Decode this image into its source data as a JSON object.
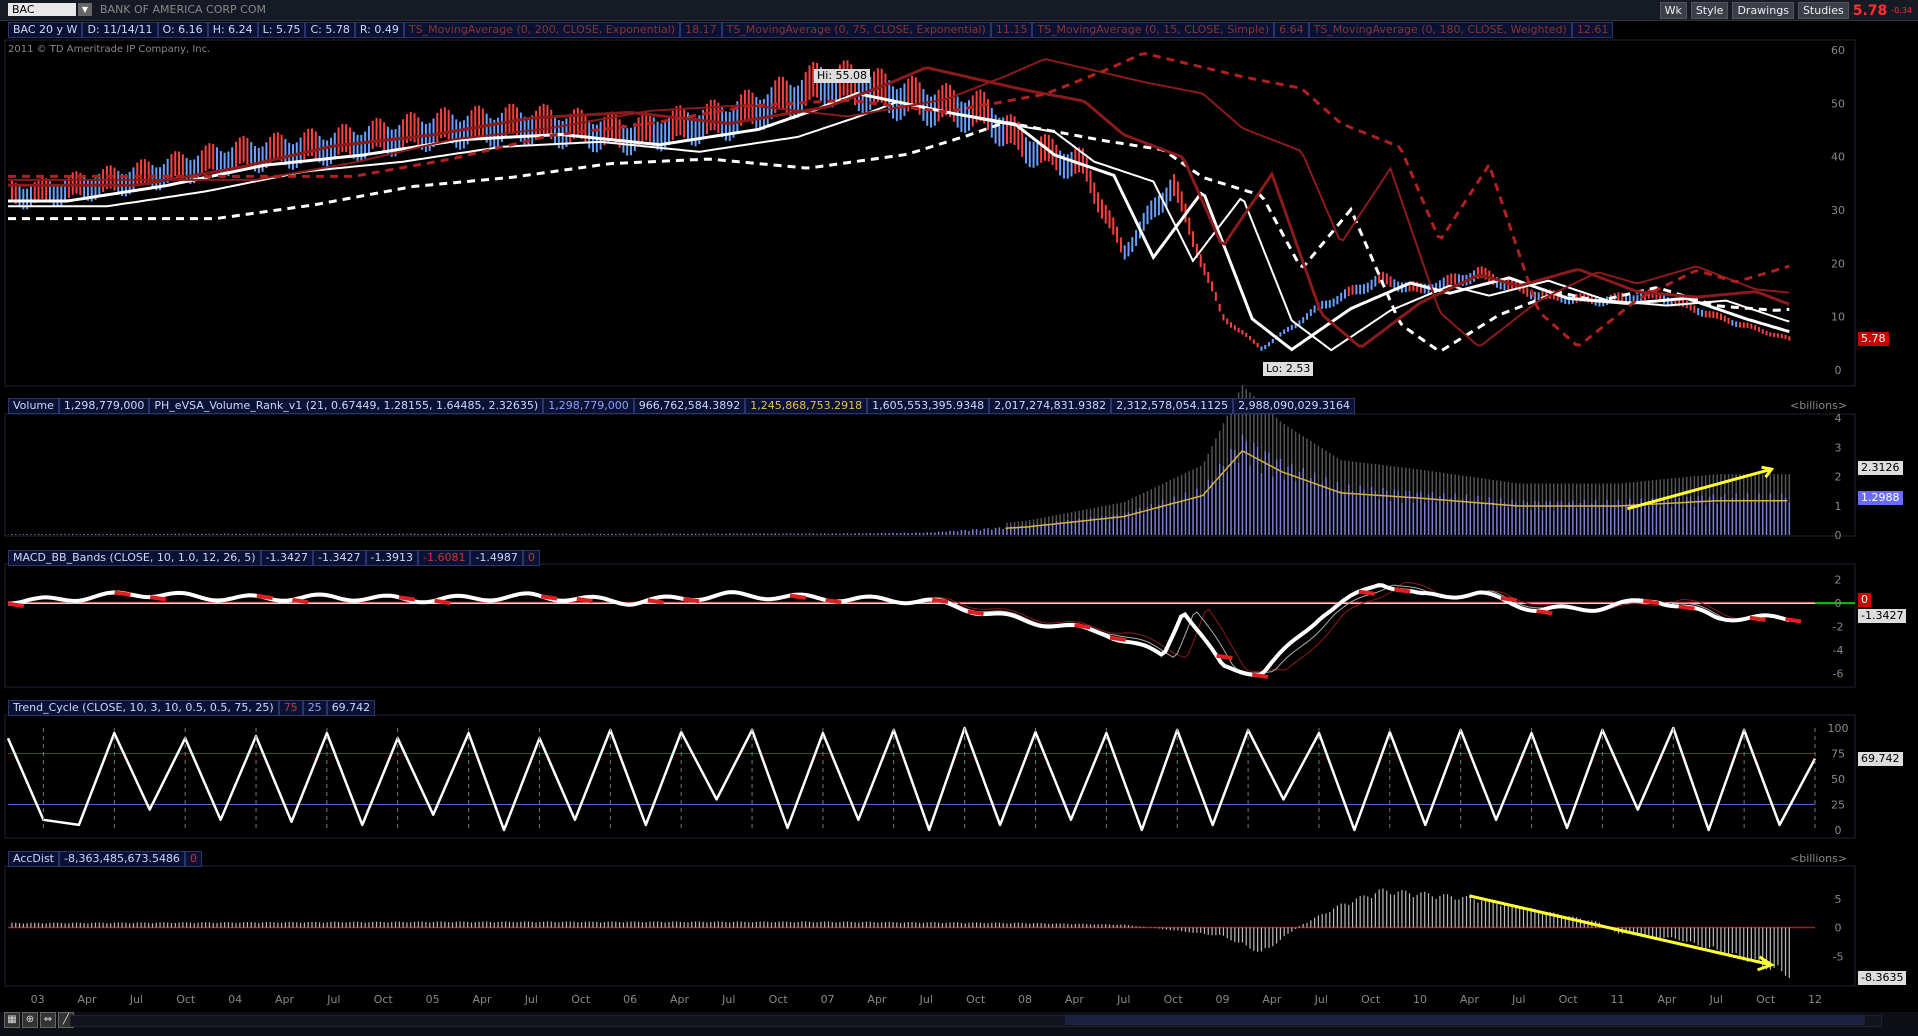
{
  "header": {
    "symbol": "BAC",
    "company": "BANK OF AMERICA CORP COM",
    "copyright": "2011 © TD Ameritrade IP Company, Inc.",
    "toolbar": [
      "Wk",
      "Style",
      "Drawings",
      "Studies"
    ],
    "last_price": "5.78",
    "change": "-0.34",
    "quote": [
      "BAC 20 y W",
      "D: 11/14/11",
      "O: 6.16",
      "H: 6.24",
      "L: 5.75",
      "C: 5.78",
      "R: 0.49"
    ],
    "studies": [
      {
        "label": "TS_MovingAverage (0, 200, CLOSE, Exponential)",
        "value": "18.17"
      },
      {
        "label": "TS_MovingAverage (0, 75, CLOSE, Exponential)",
        "value": "11.15"
      },
      {
        "label": "TS_MovingAverage (0, 15, CLOSE, Simple)",
        "value": "6.64"
      },
      {
        "label": "TS_MovingAverage (0, 180, CLOSE, Weighted)",
        "value": "12.61"
      }
    ]
  },
  "volume_header": [
    "Volume",
    "1,298,779,000",
    "PH_eVSA_Volume_Rank_v1 (21, 0.67449, 1.28155, 1.64485, 2.32635)",
    "1,298,779,000",
    "966,762,584.3892",
    "1,245,868,753.2918",
    "1,605,553,395.9348",
    "2,017,274,831.9382",
    "2,312,578,054.1125",
    "2,988,090,029.3164"
  ],
  "macd_header": [
    "MACD_BB_Bands (CLOSE, 10, 1.0, 12, 26, 5)",
    "-1.3427",
    "-1.3427",
    "-1.3913",
    "-1.6081",
    "-1.4987",
    "0"
  ],
  "trend_header": [
    "Trend_Cycle (CLOSE, 10, 3, 10, 0.5, 0.5, 75, 25)",
    "75",
    "25",
    "69.742"
  ],
  "accdist_header": [
    "AccDist",
    "-8,363,485,673.5486",
    "0"
  ],
  "units": {
    "volume": "<billions>",
    "accdist": "<billions>"
  },
  "price_annotations": {
    "hi": "Hi: 55.08",
    "lo": "Lo: 2.53",
    "last": "5.78"
  },
  "side_values": {
    "volume_a": "2.3126",
    "volume_b": "1.2988",
    "macd_zero": "0",
    "macd": "-1.3427",
    "trend": "69.742",
    "accdist": "-8.3635"
  },
  "x_ticks": [
    "03",
    "Apr",
    "Jul",
    "Oct",
    "04",
    "Apr",
    "Jul",
    "Oct",
    "05",
    "Apr",
    "Jul",
    "Oct",
    "06",
    "Apr",
    "Jul",
    "Oct",
    "07",
    "Apr",
    "Jul",
    "Oct",
    "08",
    "Apr",
    "Jul",
    "Oct",
    "09",
    "Apr",
    "Jul",
    "Oct",
    "10",
    "Apr",
    "Jul",
    "Oct",
    "11",
    "Apr",
    "Jul",
    "Oct",
    "12"
  ],
  "colors": {
    "background": "#000000",
    "up": "#6aa0ff",
    "down": "#ff4040",
    "ma_red": "#8b1a1a",
    "annotation": "#ffff33"
  },
  "chart_data": [
    {
      "type": "line",
      "title": "BAC weekly price",
      "x": [
        2003.0,
        2003.5,
        2004.0,
        2004.5,
        2005.0,
        2005.5,
        2006.0,
        2006.5,
        2006.8,
        2007.0,
        2007.5,
        2007.8,
        2008.0,
        2008.3,
        2008.5,
        2008.75,
        2009.0,
        2009.2,
        2009.5,
        2009.8,
        2010.0,
        2010.3,
        2010.6,
        2010.9,
        2011.2,
        2011.5,
        2011.87
      ],
      "series": [
        {
          "values": [
            33,
            36,
            40,
            42,
            45,
            46,
            44,
            47,
            51,
            54,
            50,
            48,
            42,
            38,
            22,
            35,
            10,
            4,
            12,
            17,
            15,
            18,
            14,
            13,
            14,
            10,
            5.78
          ]
        }
      ],
      "ylim": [
        0,
        60
      ],
      "yticks": [
        "60",
        "50",
        "40",
        "30",
        "20",
        "10",
        "0"
      ]
    },
    {
      "type": "bar",
      "title": "Volume",
      "x": [
        2003.0,
        2004.0,
        2005.0,
        2006.0,
        2007.0,
        2007.5,
        2008.0,
        2008.5,
        2008.9,
        2009.1,
        2009.3,
        2009.6,
        2010.0,
        2010.5,
        2011.0,
        2011.5,
        2011.87
      ],
      "values": [
        0.03,
        0.04,
        0.04,
        0.04,
        0.05,
        0.08,
        0.3,
        0.7,
        1.5,
        3.2,
        2.4,
        1.6,
        1.4,
        1.1,
        1.1,
        1.3,
        1.3
      ],
      "ylim": [
        0,
        4
      ],
      "yticks": [
        "4",
        "3",
        "2",
        "1",
        "0"
      ]
    },
    {
      "type": "line",
      "title": "MACD_BB_Bands",
      "x": [
        2003.0,
        2003.5,
        2004.0,
        2004.5,
        2005.0,
        2005.5,
        2006.0,
        2006.5,
        2007.0,
        2007.5,
        2008.0,
        2008.4,
        2008.7,
        2008.8,
        2009.0,
        2009.2,
        2009.5,
        2009.8,
        2010.0,
        2010.3,
        2010.6,
        2010.9,
        2011.2,
        2011.5,
        2011.87
      ],
      "values": [
        0.2,
        0.8,
        0.4,
        0.5,
        0.3,
        0.6,
        0.1,
        0.7,
        0.4,
        0.2,
        -1.5,
        -2.5,
        -4.5,
        -0.5,
        -5.5,
        -6.0,
        -1.0,
        1.8,
        0.6,
        0.8,
        -0.6,
        -0.4,
        0.3,
        -1.2,
        -1.3427
      ],
      "ylim": [
        -7,
        3
      ],
      "yticks": [
        "2",
        "0",
        "-2",
        "-4",
        "-6"
      ]
    },
    {
      "type": "line",
      "title": "Trend_Cycle",
      "values": [
        90,
        10,
        5,
        95,
        20,
        90,
        10,
        92,
        8,
        95,
        5,
        90,
        15,
        95,
        0,
        90,
        10,
        98,
        5,
        96,
        30,
        98,
        2,
        95,
        10,
        98,
        0,
        100,
        5,
        96,
        10,
        95,
        0,
        98,
        5,
        98,
        30,
        95,
        0,
        96,
        5,
        98,
        10,
        95,
        2,
        98,
        20,
        100,
        0,
        98,
        5,
        70
      ],
      "ylim": [
        0,
        100
      ],
      "yticks": [
        "100",
        "75",
        "50",
        "25",
        "0"
      ]
    },
    {
      "type": "bar",
      "title": "AccDist",
      "x": [
        2003.0,
        2005.0,
        2007.0,
        2008.0,
        2008.5,
        2009.0,
        2009.2,
        2009.4,
        2009.6,
        2009.8,
        2010.0,
        2010.3,
        2010.6,
        2010.9,
        2011.0,
        2011.3,
        2011.6,
        2011.87
      ],
      "values": [
        0.8,
        1.0,
        1.0,
        0.8,
        0.5,
        -1.5,
        -4.5,
        0.5,
        4,
        6.5,
        6,
        5,
        3,
        1,
        -1,
        -2,
        -5,
        -8.3635
      ],
      "ylim": [
        -10,
        10
      ],
      "yticks": [
        "5",
        "0",
        "-5"
      ]
    }
  ]
}
